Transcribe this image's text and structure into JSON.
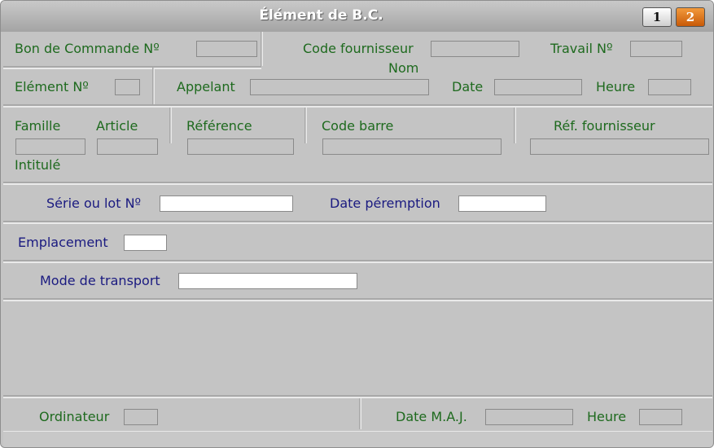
{
  "window": {
    "title": "Élément de B.C.",
    "page_buttons": [
      "1",
      "2"
    ],
    "active_page": "2"
  },
  "row1": {
    "bon_commande_label": "Bon de Commande Nº",
    "code_fournisseur_label": "Code fournisseur",
    "travail_label": "Travail Nº",
    "nom_label": "Nom"
  },
  "row2": {
    "element_label": "Elément Nº",
    "appelant_label": "Appelant",
    "date_label": "Date",
    "heure_label": "Heure"
  },
  "row3": {
    "famille_label": "Famille",
    "article_label": "Article",
    "reference_label": "Référence",
    "code_barre_label": "Code barre",
    "ref_fournisseur_label": "Réf. fournisseur",
    "intitule_label": "Intitulé"
  },
  "serie": {
    "serie_label": "Série ou lot Nº",
    "date_peremption_label": "Date péremption"
  },
  "emplacement": {
    "label": "Emplacement"
  },
  "transport": {
    "label": "Mode de transport"
  },
  "bottom": {
    "ordinateur_label": "Ordinateur",
    "date_maj_label": "Date M.A.J.",
    "heure_label": "Heure"
  },
  "colors": {
    "green_label": "#1e6a1e",
    "blue_label": "#1a1a80",
    "active_page": "#e07010"
  }
}
